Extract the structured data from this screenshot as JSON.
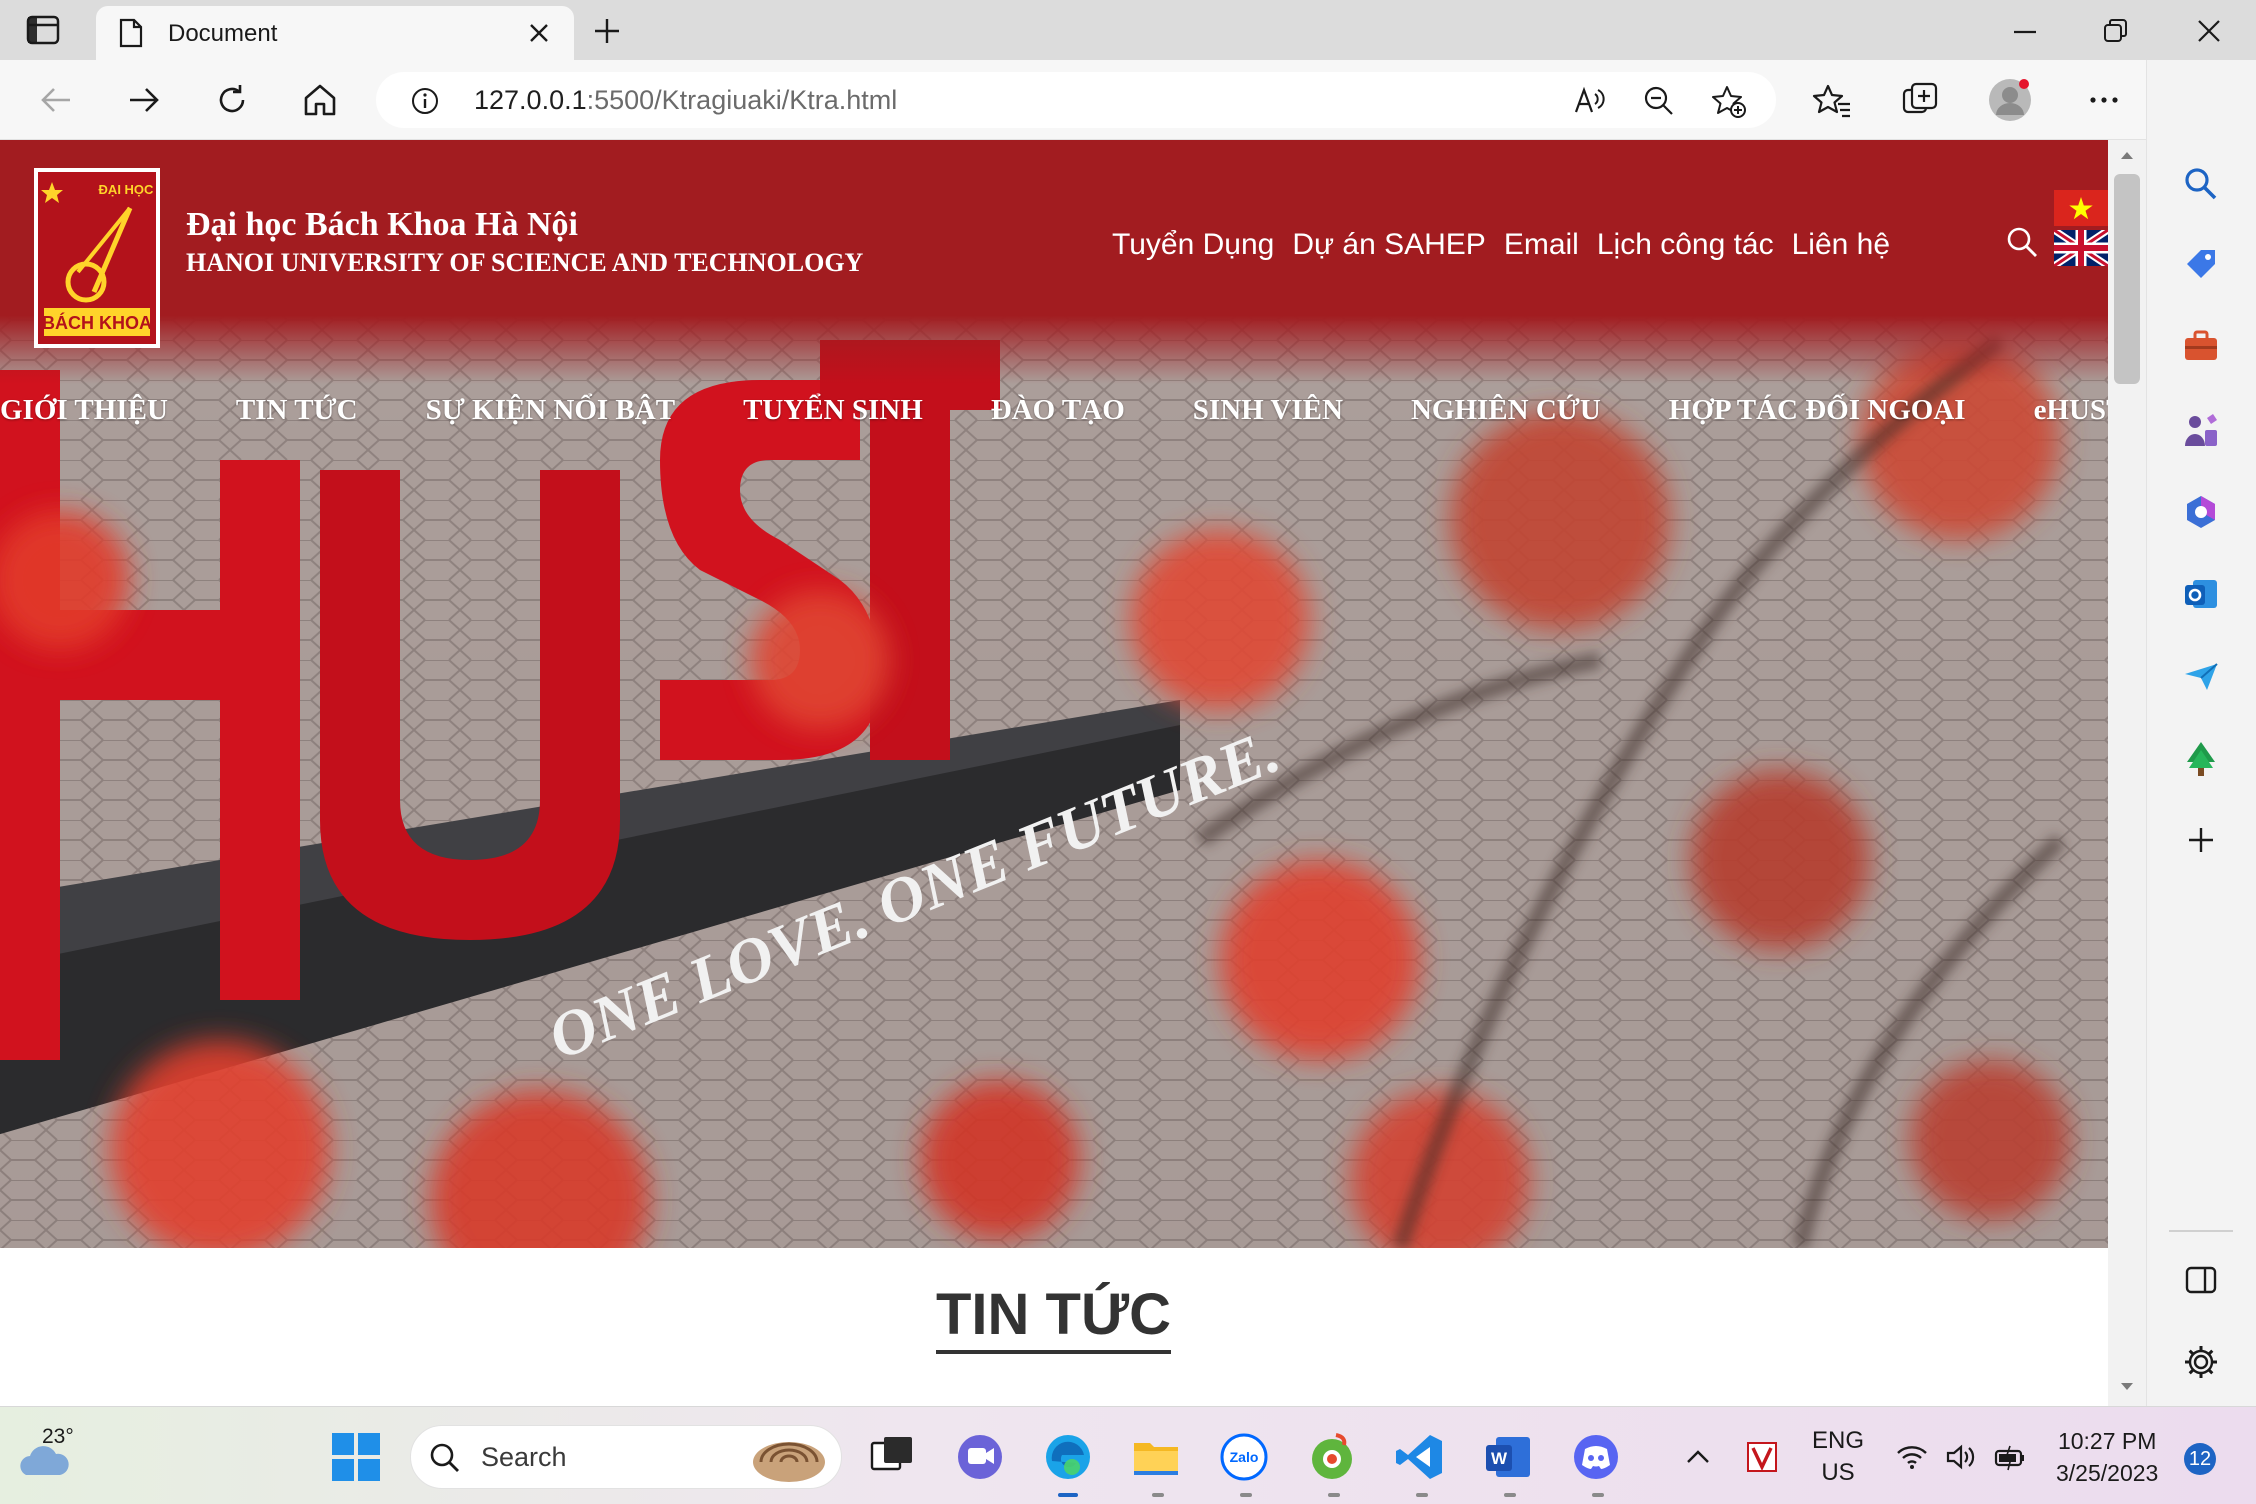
{
  "browser": {
    "tab_title": "Document",
    "url_host": "127.0.0.1",
    "url_rest": ":5500/Ktragiuaki/Ktra.html"
  },
  "site": {
    "logo_text_top": "ĐẠI HỌC",
    "logo_text_bottom": "BÁCH KHOA",
    "name_vi": "Đại học Bách Khoa Hà Nội",
    "name_en": "HANOI UNIVERSITY OF SCIENCE AND TECHNOLOGY",
    "top_links": [
      "Tuyển Dụng",
      "Dự án SAHEP",
      "Email",
      "Lịch công tác",
      "Liên hệ"
    ],
    "nav": [
      "GIỚI THIỆU",
      "TIN TỨC",
      "SỰ KIỆN NỔI BẬT",
      "TUYỂN SINH",
      "ĐÀO TẠO",
      "SINH VIÊN",
      "NGHIÊN CỨU",
      "HỢP TÁC ĐỐI NGOẠI",
      "eHUST"
    ],
    "hero_text": "HUST",
    "hero_slogan": "ONE LOVE. ONE FUTURE.",
    "section_title": "TIN TỨC"
  },
  "taskbar": {
    "temperature": "23°",
    "search_label": "Search",
    "lang_top": "ENG",
    "lang_bottom": "US",
    "time": "10:27 PM",
    "date": "3/25/2023",
    "notifications": "12"
  },
  "colors": {
    "brand_red": "#a21c20",
    "edge_blue": "#1d64c4"
  }
}
